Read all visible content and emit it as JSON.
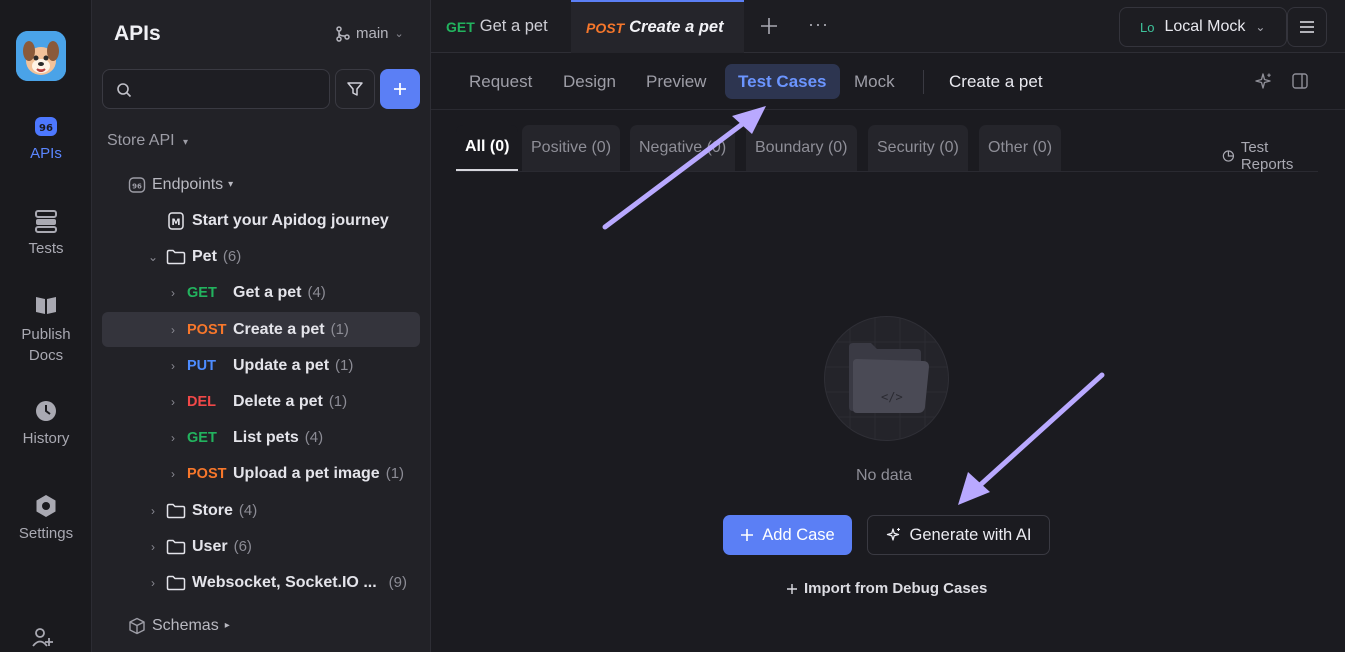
{
  "rail": {
    "items": [
      {
        "label": "APIs",
        "icon": "apis-icon",
        "active": true
      },
      {
        "label": "Tests",
        "icon": "tests-icon"
      },
      {
        "label": "Publish Docs",
        "icon": "publish-docs-icon"
      },
      {
        "label": "History",
        "icon": "history-icon"
      },
      {
        "label": "Settings",
        "icon": "settings-icon"
      }
    ]
  },
  "sidebar": {
    "title": "APIs",
    "branch": "main",
    "project": "Store API",
    "endpoints_label": "Endpoints",
    "journey": "Start your Apidog journey",
    "pet_folder": {
      "name": "Pet",
      "count": "(6)"
    },
    "endpoints": [
      {
        "method": "GET",
        "name": "Get a pet",
        "count": "(4)"
      },
      {
        "method": "POST",
        "name": "Create a pet",
        "count": "(1)"
      },
      {
        "method": "PUT",
        "name": "Update a pet",
        "count": "(1)"
      },
      {
        "method": "DEL",
        "name": "Delete a pet",
        "count": "(1)"
      },
      {
        "method": "GET",
        "name": "List pets",
        "count": "(4)"
      },
      {
        "method": "POST",
        "name": "Upload a pet image",
        "count": "(1)"
      }
    ],
    "folders": [
      {
        "name": "Store",
        "count": "(4)"
      },
      {
        "name": "User",
        "count": "(6)"
      },
      {
        "name": "Websocket, Socket.IO ...",
        "count": "(9)"
      }
    ],
    "schemas_label": "Schemas"
  },
  "tabs": [
    {
      "method": "GET",
      "label": "Get a pet"
    },
    {
      "method": "POST",
      "label": "Create a pet"
    }
  ],
  "env": {
    "badge": "Lo",
    "label": "Local Mock"
  },
  "subtabs": [
    "Request",
    "Design",
    "Preview",
    "Test Cases",
    "Mock"
  ],
  "subtitle": "Create a pet",
  "filters": [
    "All (0)",
    "Positive (0)",
    "Negative (0)",
    "Boundary (0)",
    "Security (0)",
    "Other (0)"
  ],
  "test_reports": "Test Reports",
  "empty": {
    "no_data": "No data",
    "add_case": "Add Case",
    "generate_ai": "Generate with AI",
    "import": "Import from Debug Cases"
  },
  "colors": {
    "accent": "#5b7ff5",
    "get": "#22b35e",
    "post": "#f7772b",
    "put": "#4d8cff",
    "del": "#f04848",
    "annotation_arrow": "#b9a9ff"
  }
}
